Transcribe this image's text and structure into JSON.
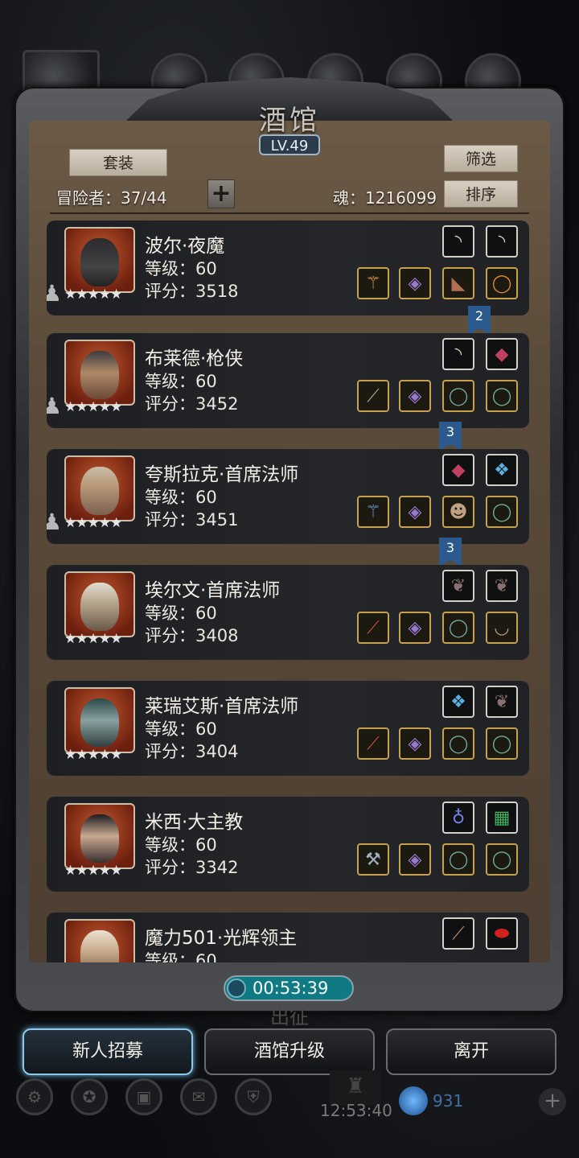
{
  "header": {
    "title": "酒馆",
    "level": "LV.49",
    "set_button": "套装",
    "filter_button": "筛选",
    "sort_button": "排序",
    "adventurer_label": "冒险者：37/44",
    "soul_label": "魂：1216099",
    "plus_symbol": "+"
  },
  "adventurers": [
    {
      "name": "波尔·夜魔",
      "level": "等级：60",
      "score": "评分：3518",
      "stars": "★★★★★"
    },
    {
      "name": "布莱德·枪侠",
      "level": "等级：60",
      "score": "评分：3452",
      "stars": "★★★★★"
    },
    {
      "name": "夸斯拉克·首席法师",
      "level": "等级：60",
      "score": "评分：3451",
      "stars": "★★★★★"
    },
    {
      "name": "埃尔文·首席法师",
      "level": "等级：60",
      "score": "评分：3408",
      "stars": "★★★★★"
    },
    {
      "name": "莱瑞艾斯·首席法师",
      "level": "等级：60",
      "score": "评分：3404",
      "stars": "★★★★★"
    },
    {
      "name": "米西·大主教",
      "level": "等级：60",
      "score": "评分：3342",
      "stars": "★★★★★"
    },
    {
      "name": "魔力501·光辉领主",
      "level": "等级：60",
      "score": "",
      "stars": "★★★★★"
    }
  ],
  "ribbons": [
    "2",
    "3",
    "3"
  ],
  "timer": "00:53:39",
  "depart_label": "出征",
  "buttons": {
    "recruit": "新人招募",
    "upgrade": "酒馆升级",
    "leave": "离开"
  },
  "bottom_bar": {
    "time": "12:53:40",
    "gems": "931",
    "add_symbol": "+"
  }
}
